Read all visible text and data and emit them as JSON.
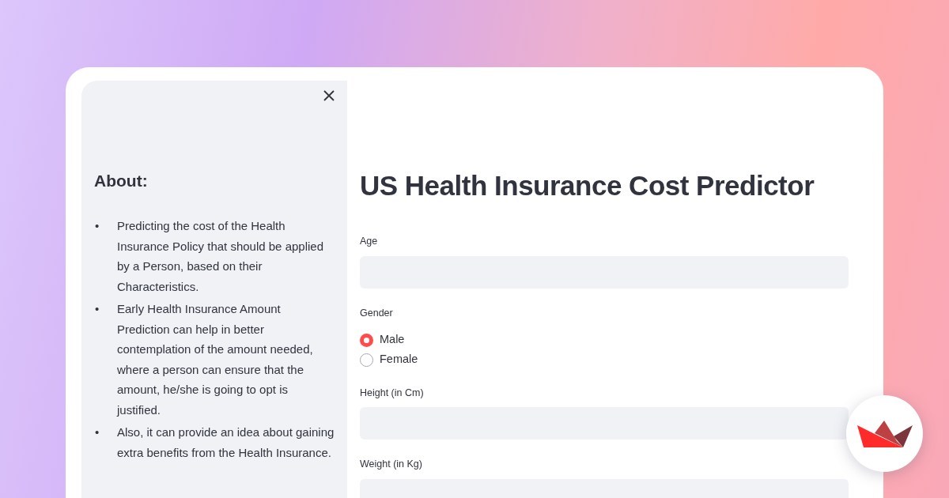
{
  "sidebar": {
    "heading": "About:",
    "items": [
      {
        "bullet": "•",
        "text": "Predicting the cost of the Health Insurance Policy that should be applied by a Person, based on their Characteristics."
      },
      {
        "bullet": "•",
        "text": "Early Health Insurance Amount Prediction can help in better contemplation of the amount needed, where a person can ensure that the amount, he/she is going to opt is justified."
      },
      {
        "bullet": "•",
        "text": "Also, it can provide an idea about gaining extra benefits from the Health Insurance."
      }
    ]
  },
  "main": {
    "title": "US Health Insurance Cost Predictor",
    "fields": [
      {
        "kind": "input",
        "label": "Age"
      },
      {
        "kind": "radio",
        "label": "Gender",
        "options": [
          {
            "label": "Male",
            "selected": true
          },
          {
            "label": "Female",
            "selected": false
          }
        ]
      },
      {
        "kind": "input",
        "label": "Height (in Cm)"
      },
      {
        "kind": "input",
        "label": "Weight (in Kg)"
      }
    ]
  }
}
